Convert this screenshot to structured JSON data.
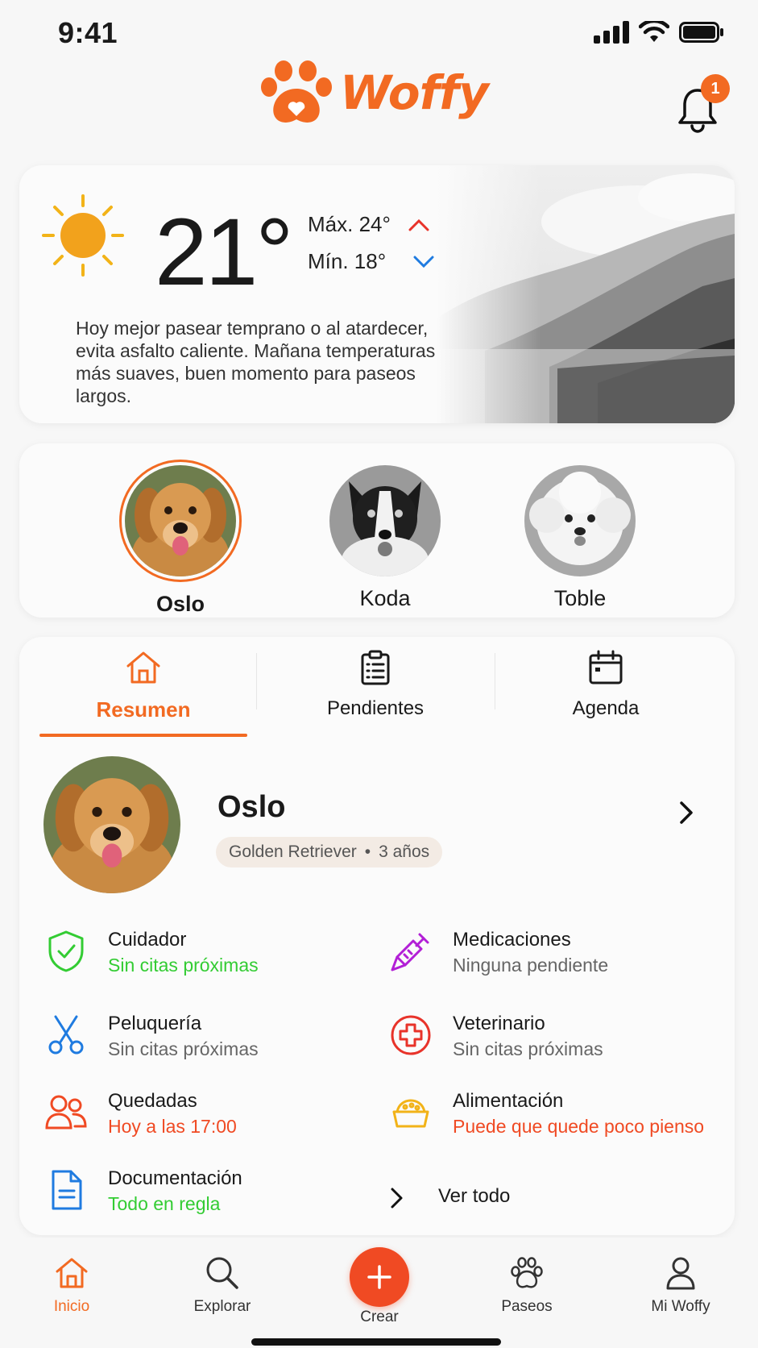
{
  "status": {
    "time": "9:41"
  },
  "header": {
    "brand": "Woffy",
    "notifications_count": "1"
  },
  "weather": {
    "temperature": "21°",
    "max": "Máx. 24°",
    "min": "Mín. 18°",
    "message": "Hoy mejor pasear temprano o al atardecer, evita asfalto caliente. Mañana temperaturas más suaves, buen momento para paseos largos."
  },
  "pets": [
    {
      "name": "Oslo",
      "selected": true
    },
    {
      "name": "Koda",
      "selected": false
    },
    {
      "name": "Toble",
      "selected": false
    }
  ],
  "tabs": [
    {
      "label": "Resumen",
      "active": true
    },
    {
      "label": "Pendientes",
      "active": false
    },
    {
      "label": "Agenda",
      "active": false
    }
  ],
  "profile": {
    "name": "Oslo",
    "breed": "Golden Retriever",
    "age": "3 años"
  },
  "features": [
    {
      "title": "Cuidador",
      "status": "Sin citas próximas",
      "icon": "shield-check-icon",
      "status_color": "#33cc33"
    },
    {
      "title": "Medicaciones",
      "status": "Ninguna pendiente",
      "icon": "syringe-icon",
      "status_color": "#666666"
    },
    {
      "title": "Peluquería",
      "status": "Sin citas próximas",
      "icon": "scissors-icon",
      "status_color": "#666666"
    },
    {
      "title": "Veterinario",
      "status": "Sin citas próximas",
      "icon": "medical-cross-icon",
      "status_color": "#666666"
    },
    {
      "title": "Quedadas",
      "status": "Hoy a las 17:00",
      "icon": "people-icon",
      "status_color": "#f04a23"
    },
    {
      "title": "Alimentación",
      "status": "Puede que quede poco pienso",
      "icon": "food-bowl-icon",
      "status_color": "#f04a23"
    },
    {
      "title": "Documentación",
      "status": "Todo en regla",
      "icon": "document-icon",
      "status_color": "#33cc33"
    }
  ],
  "see_all": "Ver todo",
  "nav": [
    {
      "label": "Inicio",
      "active": true
    },
    {
      "label": "Explorar",
      "active": false
    },
    {
      "label": "Crear",
      "active": false
    },
    {
      "label": "Paseos",
      "active": false
    },
    {
      "label": "Mi Woffy",
      "active": false
    }
  ],
  "colors": {
    "accent": "#f26a22",
    "green": "#33cc33",
    "red": "#f04a23",
    "purple": "#b21fd6",
    "blue": "#1f7be0",
    "yellow": "#f2b318"
  }
}
